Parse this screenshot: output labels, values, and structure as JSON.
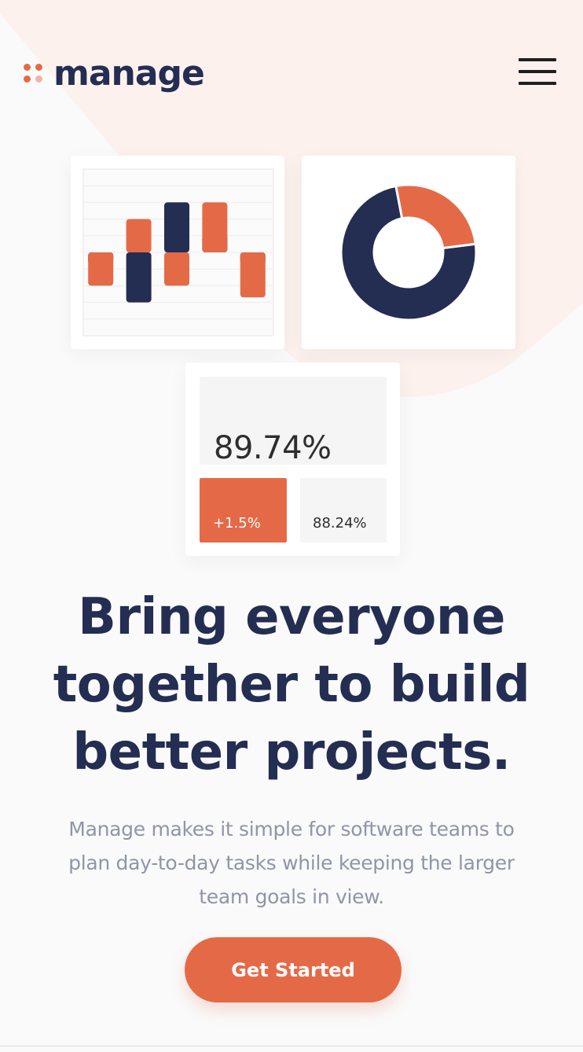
{
  "brand": {
    "name": "manage",
    "accent": "#e46a47",
    "accent_light": "#f2b4a2",
    "navy": "#242d52",
    "background": "#fafafa"
  },
  "nav": {
    "menu_icon": "hamburger-menu-icon"
  },
  "chart_data": [
    {
      "type": "bar",
      "categories": [
        "",
        "",
        "",
        "",
        ""
      ],
      "series": [
        {
          "values": [
            -2,
            2,
            -2,
            3,
            -2.7
          ]
        },
        {
          "values": [
            -0.7,
            -3,
            3,
            1,
            -0.7
          ]
        }
      ],
      "title": "",
      "xlabel": "",
      "ylabel": "",
      "ylim": [
        -5,
        5
      ],
      "grid": true,
      "colors": [
        "#e46a47",
        "#242d52"
      ]
    },
    {
      "type": "pie",
      "labels": [
        "",
        ""
      ],
      "values": [
        74,
        26
      ],
      "donut": true,
      "colors": [
        "#242d52",
        "#e46a47"
      ]
    }
  ],
  "stats": {
    "main_value": "89.74%",
    "change_value": "+1.5%",
    "secondary_value": "88.24%"
  },
  "hero": {
    "title_lines": [
      "Bring everyone",
      "together to build",
      "better projects."
    ],
    "subtitle": "Manage makes it simple for software teams to plan day-to-day tasks while keeping the larger team goals in view.",
    "cta_label": "Get Started"
  }
}
